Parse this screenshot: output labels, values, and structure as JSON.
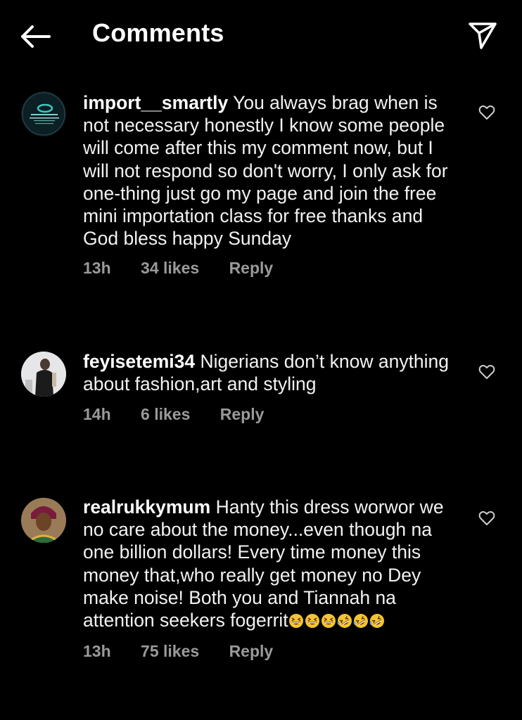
{
  "header": {
    "title": "Comments"
  },
  "comments": [
    {
      "username": "import__smartly",
      "text": "You always brag when is not necessary honestly I know some people will come after this my comment now, but I will not respond so don't worry, I only ask for one-thing just go my page and join the free mini importation class for free thanks and God bless happy Sunday",
      "time": "13h",
      "likes": "34 likes",
      "reply": "Reply"
    },
    {
      "username": "feyisetemi34",
      "text": "Nigerians don’t know anything about fashion,art and styling",
      "time": "14h",
      "likes": "6 likes",
      "reply": "Reply"
    },
    {
      "username": "realrukkymum",
      "text": "Hanty this dress worwor we no care about the money...even though na one billion dollars! Every time money this money that,who really get money no Dey make noise! Both you and Tiannah na attention seekers fogerrit",
      "emojis": [
        "grinning-squinting-face",
        "grinning-squinting-face",
        "grinning-squinting-face",
        "rolling-on-floor-laughing",
        "rolling-on-floor-laughing",
        "rolling-on-floor-laughing"
      ],
      "time": "13h",
      "likes": "75 likes",
      "reply": "Reply"
    }
  ],
  "icons": {
    "back": "arrow-left-icon",
    "share": "paper-plane-icon",
    "like": "heart-outline-icon"
  },
  "colors": {
    "background": "#000000",
    "text": "#f2f2f2",
    "meta": "#9a9a9a",
    "emoji": "#f4c430"
  }
}
